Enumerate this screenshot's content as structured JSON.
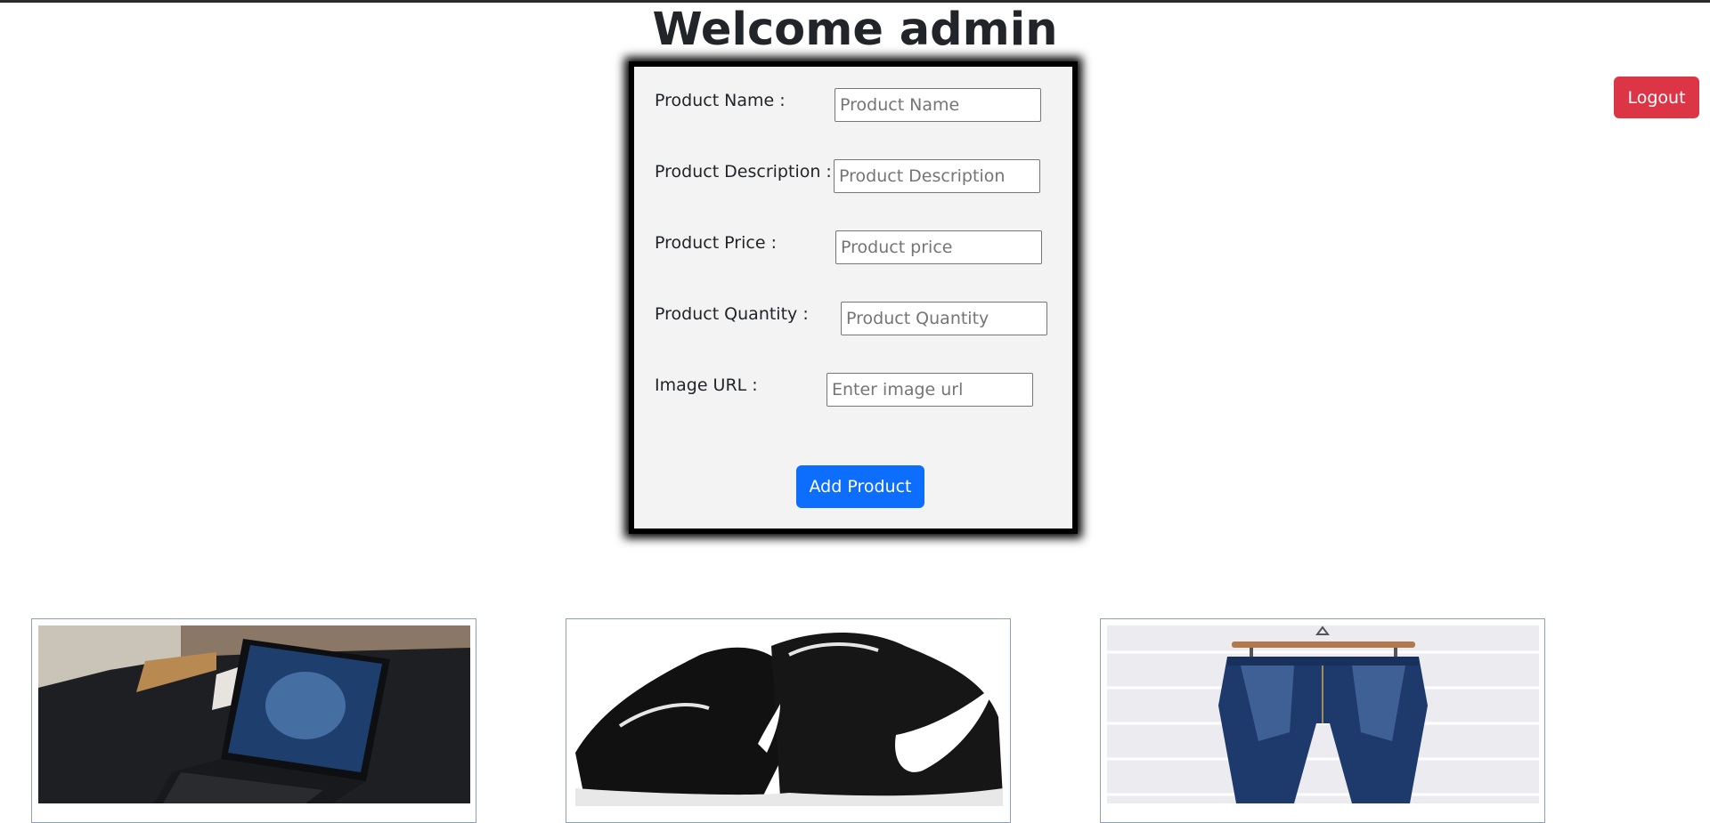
{
  "header": {
    "title": "Welcome admin",
    "logout_label": "Logout"
  },
  "form": {
    "fields": [
      {
        "label": "Product Name :",
        "placeholder": "Product Name"
      },
      {
        "label": "Product Description :",
        "placeholder": "Product Description"
      },
      {
        "label": "Product Price :",
        "placeholder": "Product price"
      },
      {
        "label": "Product Quantity :",
        "placeholder": "Product Quantity"
      },
      {
        "label": "Image URL :",
        "placeholder": "Enter image url"
      }
    ],
    "submit_label": "Add Product"
  },
  "products": [
    {
      "image": "laptop-image"
    },
    {
      "image": "sneakers-image"
    },
    {
      "image": "jeans-image"
    }
  ],
  "colors": {
    "logout": "#dc3545",
    "primary": "#0d6efd",
    "panel_background": "#f3f3f3",
    "panel_border": "#000000"
  }
}
